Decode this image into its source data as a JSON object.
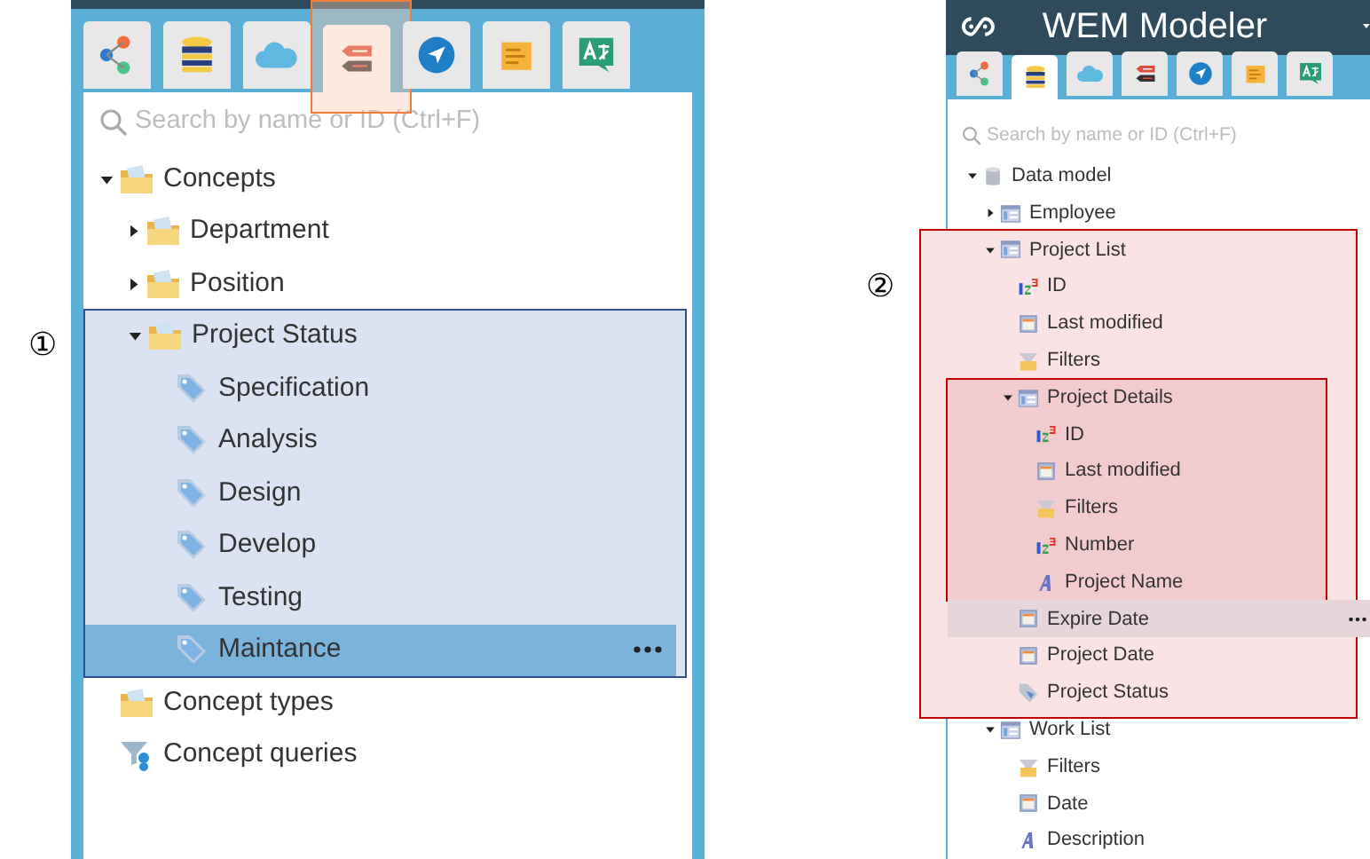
{
  "left_panel": {
    "marker": "①",
    "tabs": [
      {
        "kind": "share",
        "selected": false,
        "marked": false
      },
      {
        "kind": "database",
        "selected": false,
        "marked": false
      },
      {
        "kind": "cloud",
        "selected": false,
        "marked": false
      },
      {
        "kind": "tags",
        "selected": true,
        "marked": true
      },
      {
        "kind": "navigate",
        "selected": false,
        "marked": false
      },
      {
        "kind": "note",
        "selected": false,
        "marked": false
      },
      {
        "kind": "translate",
        "selected": false,
        "marked": false
      }
    ],
    "search": {
      "placeholder": "Search by name or ID (Ctrl+F)"
    },
    "tree": [
      {
        "label": "Concepts",
        "kind": "folder",
        "expanded": true,
        "selected": false,
        "highlighted": false,
        "children": [
          {
            "label": "Department",
            "kind": "folder",
            "expanded": false,
            "selected": false,
            "highlighted": false
          },
          {
            "label": "Position",
            "kind": "folder",
            "expanded": false,
            "selected": false,
            "highlighted": false
          },
          {
            "label": "Project Status",
            "kind": "folder",
            "expanded": true,
            "selected": false,
            "highlighted": true,
            "children": [
              {
                "label": "Specification",
                "kind": "tag",
                "selected": false,
                "highlighted": false
              },
              {
                "label": "Analysis",
                "kind": "tag",
                "selected": false,
                "highlighted": false
              },
              {
                "label": "Design",
                "kind": "tag",
                "selected": false,
                "highlighted": false
              },
              {
                "label": "Develop",
                "kind": "tag",
                "selected": false,
                "highlighted": false
              },
              {
                "label": "Testing",
                "kind": "tag",
                "selected": false,
                "highlighted": false
              },
              {
                "label": "Maintance",
                "kind": "tag",
                "selected": true,
                "highlighted": false
              }
            ]
          }
        ]
      },
      {
        "label": "Concept types",
        "kind": "folder",
        "selected": false,
        "highlighted": false
      },
      {
        "label": "Concept queries",
        "kind": "query",
        "selected": false,
        "highlighted": false
      }
    ]
  },
  "right_panel": {
    "marker": "②",
    "title": "WEM Modeler",
    "tabs": [
      {
        "kind": "share",
        "selected": false,
        "marked": false
      },
      {
        "kind": "database",
        "selected": true,
        "marked": false
      },
      {
        "kind": "cloud",
        "selected": false,
        "marked": false
      },
      {
        "kind": "tags",
        "selected": false,
        "marked": false
      },
      {
        "kind": "navigate",
        "selected": false,
        "marked": false
      },
      {
        "kind": "note",
        "selected": false,
        "marked": false
      },
      {
        "kind": "translate",
        "selected": false,
        "marked": false
      }
    ],
    "search": {
      "placeholder": "Search by name or ID (Ctrl+F)"
    },
    "tree": [
      {
        "label": "Data model",
        "kind": "db",
        "expanded": true,
        "selected": false,
        "highlighted": false,
        "children": [
          {
            "label": "Employee",
            "kind": "entity",
            "expanded": false,
            "selected": false,
            "highlighted": false
          },
          {
            "label": "Project List",
            "kind": "entity",
            "expanded": true,
            "selected": false,
            "highlighted": true,
            "children": [
              {
                "label": "ID",
                "kind": "number",
                "selected": false,
                "highlighted": false
              },
              {
                "label": "Last modified",
                "kind": "date",
                "selected": false,
                "highlighted": false
              },
              {
                "label": "Filters",
                "kind": "filter",
                "selected": false,
                "highlighted": false
              },
              {
                "label": "Project Details",
                "kind": "entity",
                "expanded": true,
                "selected": false,
                "highlighted": true,
                "children": [
                  {
                    "label": "ID",
                    "kind": "number",
                    "selected": false,
                    "highlighted": false
                  },
                  {
                    "label": "Last modified",
                    "kind": "date",
                    "selected": false,
                    "highlighted": false
                  },
                  {
                    "label": "Filters",
                    "kind": "filter",
                    "selected": false,
                    "highlighted": false
                  },
                  {
                    "label": "Number",
                    "kind": "number",
                    "selected": false,
                    "highlighted": false
                  },
                  {
                    "label": "Project Name",
                    "kind": "text",
                    "selected": false,
                    "highlighted": false
                  }
                ]
              },
              {
                "label": "Expire Date",
                "kind": "date",
                "selected": true,
                "highlighted": false
              },
              {
                "label": "Project Date",
                "kind": "date",
                "selected": false,
                "highlighted": false
              },
              {
                "label": "Project Status",
                "kind": "concept",
                "selected": false,
                "highlighted": false
              }
            ]
          },
          {
            "label": "Work List",
            "kind": "entity",
            "expanded": true,
            "selected": false,
            "highlighted": false,
            "children": [
              {
                "label": "Filters",
                "kind": "filter",
                "selected": false,
                "highlighted": false
              },
              {
                "label": "Date",
                "kind": "date",
                "selected": false,
                "highlighted": false
              },
              {
                "label": "Description",
                "kind": "text",
                "selected": false,
                "highlighted": false
              }
            ]
          }
        ]
      }
    ]
  }
}
